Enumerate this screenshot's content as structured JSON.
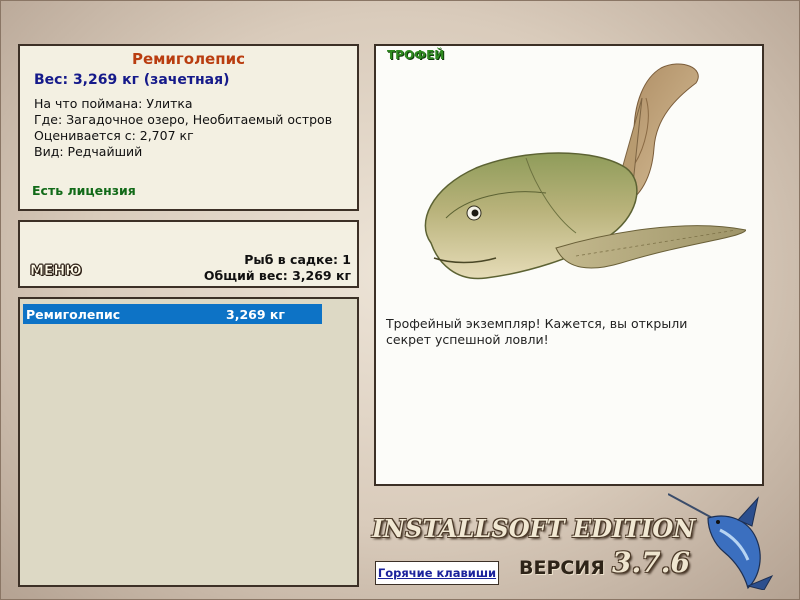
{
  "fish_info": {
    "name": "Ремиголепис",
    "weight": "Вес: 3,269 кг (зачетная)",
    "details": [
      "На что поймана: Улитка",
      "Где: Загадочное озеро, Необитаемый остров",
      "Оценивается с: 2,707 кг",
      "Вид: Редчайший"
    ],
    "license": "Есть лицензия"
  },
  "keepnet": {
    "menu_label": "МЕНЮ",
    "fish_count": "Рыб в садке: 1",
    "total_weight": "Общий вес: 3,269 кг"
  },
  "list": {
    "rows": [
      {
        "name": "Ремиголепис",
        "weight": "3,269 кг",
        "selected": true
      }
    ]
  },
  "trophy": {
    "label": "ТРОФЕЙ",
    "message": "Трофейный экземпляр! Кажется, вы открыли секрет успешной ловли!",
    "image": "remigolepis-fish"
  },
  "footer": {
    "brand": "INSTALLSOFT EDITION",
    "version_label": "ВЕРСИЯ",
    "version_number": "3.7.6",
    "hotkeys_label": "Горячие клавиши",
    "logo": "marlin-icon"
  },
  "colors": {
    "fish_name": "#b93d10",
    "weight": "#151a8a",
    "license": "#116a18",
    "selection": "#0d73c6",
    "trophy_label": "#2f8a20"
  }
}
